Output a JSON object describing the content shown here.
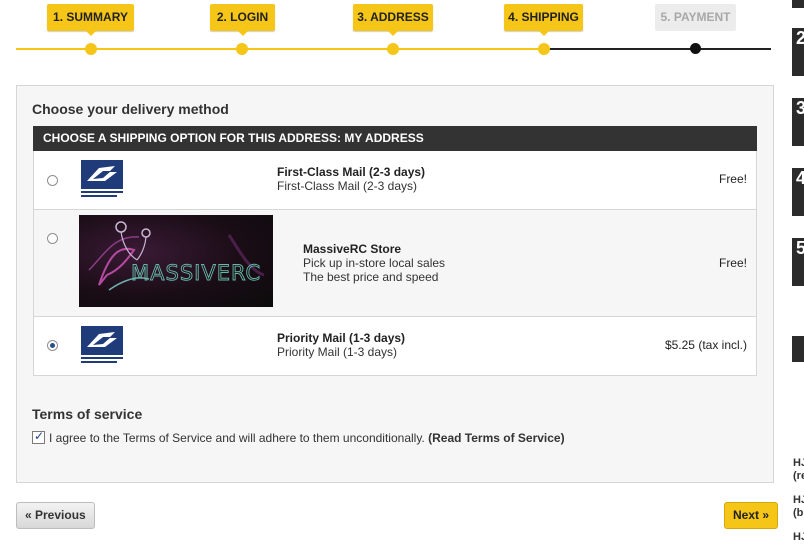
{
  "steps": [
    {
      "label": "1. SUMMARY",
      "state": "done"
    },
    {
      "label": "2. LOGIN",
      "state": "done"
    },
    {
      "label": "3. ADDRESS",
      "state": "done"
    },
    {
      "label": "4. SHIPPING",
      "state": "current"
    },
    {
      "label": "5. PAYMENT",
      "state": "todo"
    }
  ],
  "right_column": {
    "numbers": [
      "2",
      "3",
      "4",
      "5"
    ],
    "text_fragments": [
      "HJ",
      "(re",
      "HJ",
      "(b",
      "HJ"
    ]
  },
  "delivery": {
    "title": "Choose your delivery method",
    "header": "CHOOSE A SHIPPING OPTION FOR THIS ADDRESS: MY ADDRESS",
    "options": [
      {
        "name": "First-Class Mail (2-3 days)",
        "desc1": "First-Class Mail (2-3 days)",
        "price": "Free!",
        "logo": "usps-eagle-logo",
        "logo_text": "UNITED STATES POSTAL SERVICE",
        "selected": false
      },
      {
        "name": "MassiveRC Store",
        "desc1": "Pick up in-store local sales",
        "desc2": "The best price and speed",
        "price": "Free!",
        "logo": "massiverc-logo",
        "logo_text": "MASSIVERC",
        "selected": false
      },
      {
        "name": "Priority Mail (1-3 days)",
        "desc1": "Priority Mail (1-3 days)",
        "price": "$5.25 (tax incl.)",
        "logo": "usps-eagle-logo",
        "logo_text": "UNITED STATES POSTAL SERVICE",
        "selected": true
      }
    ]
  },
  "tos": {
    "title": "Terms of service",
    "agree_text": "I agree to the Terms of Service and will adhere to them unconditionally.",
    "link_text": "(Read Terms of Service)",
    "checked": true
  },
  "nav": {
    "prev_label": "« Previous",
    "next_label": "Next »"
  },
  "colors": {
    "accent": "#f5c518",
    "header_bg": "#333333",
    "usps_blue": "#1f3b7a"
  }
}
